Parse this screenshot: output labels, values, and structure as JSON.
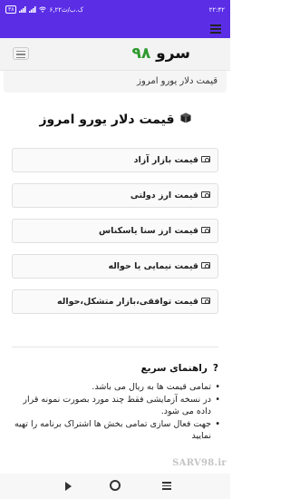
{
  "status_bar": {
    "time": "۲۲:۴۲",
    "network_speed": "۶,۲۲ک.ب/ث",
    "battery": "۳۸"
  },
  "header": {
    "logo_word": "سرو",
    "logo_number": "۹۸"
  },
  "breadcrumb": {
    "current": "قیمت دلار یورو امروز"
  },
  "main": {
    "title": "قیمت دلار یورو امروز",
    "categories": [
      {
        "label": "قیمت بازار آزاد"
      },
      {
        "label": "قیمت ارز دولتی"
      },
      {
        "label": "قیمت ارز سنا یاسکناس"
      },
      {
        "label": "قیمت نیمایی یا حواله"
      },
      {
        "label": "قیمت توافقی،بازار متشکل،حواله"
      }
    ]
  },
  "guide": {
    "title": "راهنمای سریع",
    "items": [
      "تمامی قیمت ها به ریال می باشد.",
      "در نسخه آزمایشی فقط چند مورد بصورت نمونه قرار داده می شود.",
      "",
      "جهت فعال سازی تمامی بخش ها اشتراک برنامه را تهیه نمایید"
    ]
  },
  "watermark": "SARV98.ir",
  "colors": {
    "status_bar": "#5b2ee6",
    "logo_number": "#2e9a2e"
  },
  "icons": {
    "page_title": "cube-icon",
    "category": "money-bill-icon",
    "guide": "question-icon"
  }
}
